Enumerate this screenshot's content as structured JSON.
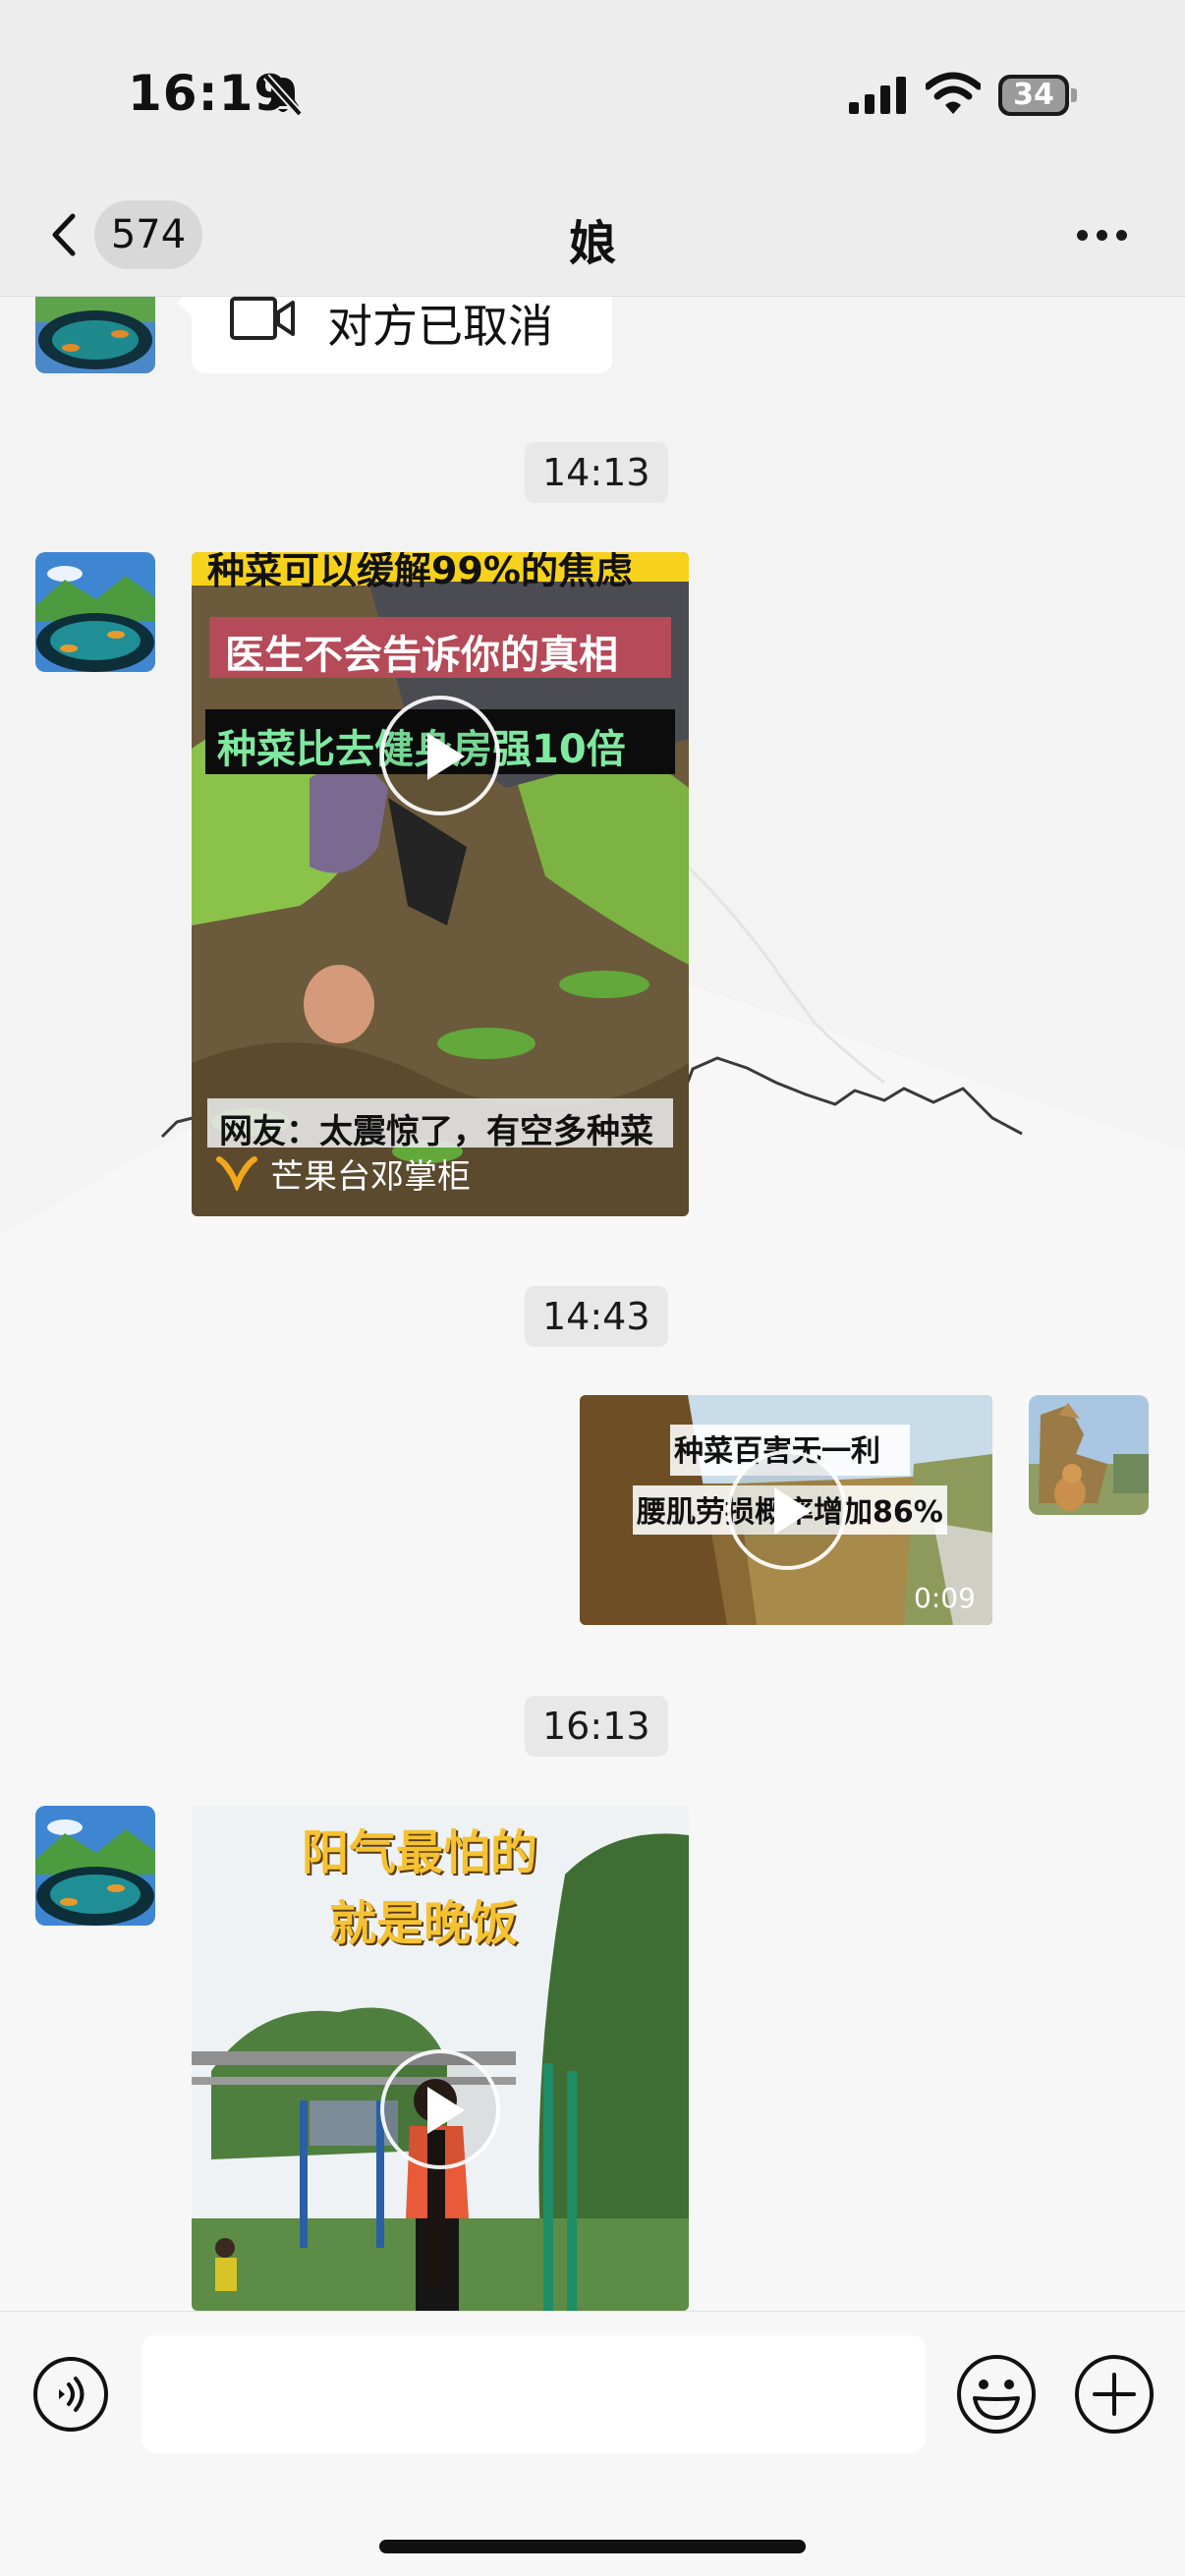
{
  "status_bar": {
    "time": "16:19",
    "battery": "34",
    "icons": [
      "bell-muted-icon",
      "cellular-signal-icon",
      "wifi-icon",
      "battery-icon"
    ]
  },
  "nav": {
    "back_icon": "chevron-left-icon",
    "unread_count": "574",
    "title": "娘",
    "more_icon": "more-dots-icon"
  },
  "messages": [
    {
      "type": "call",
      "sender": "contact",
      "icon": "video-call-icon",
      "text": "对方已取消"
    },
    {
      "type": "timestamp",
      "text": "14:13"
    },
    {
      "type": "video",
      "sender": "contact",
      "captions": {
        "top_banner": "种菜可以缓解99%的焦虑",
        "red_caption": "医生不会告诉你的真相",
        "green_caption": "种菜比去健身房强10倍",
        "bottom_caption": "网友：太震惊了，有空多种菜",
        "channel": "芒果台邓掌柜"
      }
    },
    {
      "type": "timestamp",
      "text": "14:43"
    },
    {
      "type": "video",
      "sender": "me",
      "captions": {
        "line1": "种菜百害无一利",
        "line2": "腰肌劳损概率增加86%"
      },
      "duration": "0:09"
    },
    {
      "type": "timestamp",
      "text": "16:13"
    },
    {
      "type": "video",
      "sender": "contact",
      "captions": {
        "line1": "阳气最怕的",
        "line2": "就是晚饭"
      }
    }
  ],
  "input_bar": {
    "voice_icon": "voice-input-icon",
    "input_value": "",
    "emoji_icon": "emoji-icon",
    "plus_icon": "plus-circle-icon"
  },
  "colors": {
    "chrome_bg": "#ededed",
    "chat_bg": "#f3f3f3",
    "bubble_bg": "#ffffff",
    "timestamp_bg": "#e8e8e8"
  }
}
